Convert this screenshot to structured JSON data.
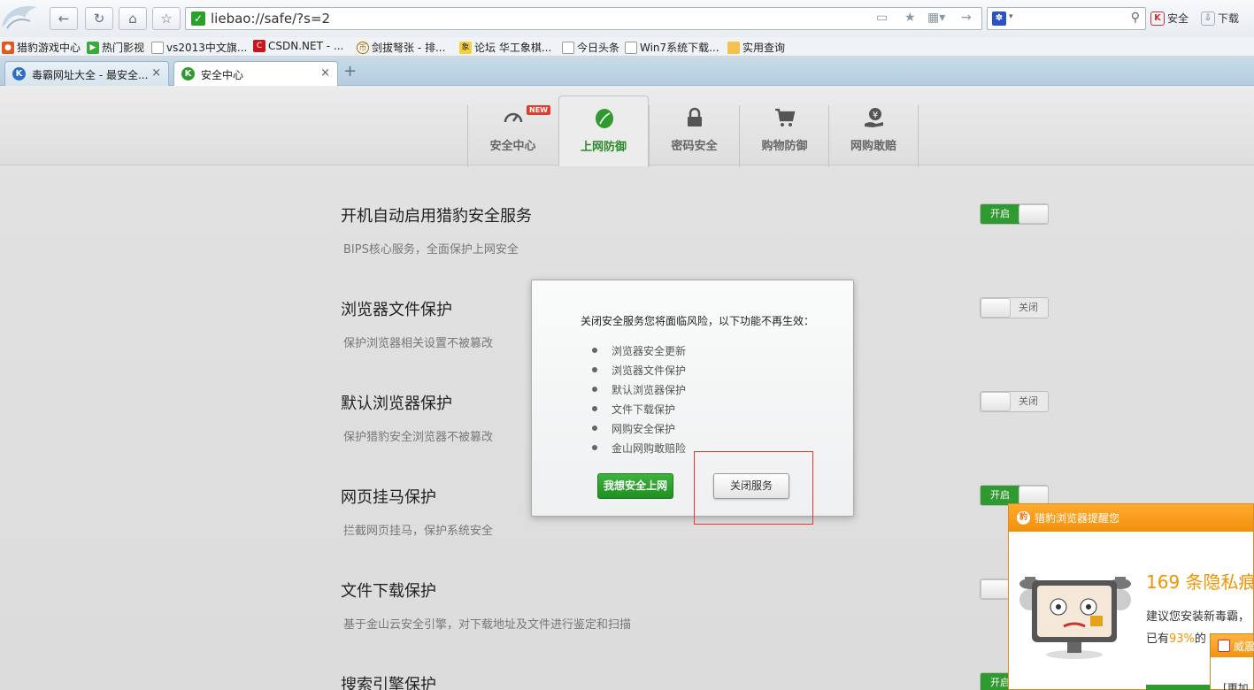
{
  "browser": {
    "url": "liebao://safe/?s=2",
    "toolbar_right": {
      "security": "安全",
      "download": "下载"
    },
    "bookmarks": [
      "猎豹游戏中心",
      "热门影视",
      "vs2013中文旗...",
      "CSDN.NET - ...",
      "剑拔弩张 - 排...",
      "论坛 华工象棋...",
      "今日头条",
      "Win7系统下载...",
      "实用查询"
    ],
    "tabs": [
      {
        "label": "毒霸网址大全 - 最安全...",
        "close": "×"
      },
      {
        "label": "安全中心",
        "close": "×"
      }
    ],
    "new_tab": "+"
  },
  "nav": {
    "items": [
      {
        "label": "安全中心",
        "icon": "speedometer-icon",
        "badge": "NEW"
      },
      {
        "label": "上网防御",
        "icon": "leaf-shield-icon"
      },
      {
        "label": "密码安全",
        "icon": "lock-icon"
      },
      {
        "label": "购物防御",
        "icon": "cart-icon"
      },
      {
        "label": "网购敢赔",
        "icon": "yuan-hand-icon"
      }
    ]
  },
  "settings": [
    {
      "title": "开机自动启用猎豹安全服务",
      "desc": "BIPS核心服务，全面保护上网安全",
      "state": "开启"
    },
    {
      "title": "浏览器文件保护",
      "desc": "保护浏览器相关设置不被篡改",
      "state": "关闭"
    },
    {
      "title": "默认浏览器保护",
      "desc": "保护猎豹安全浏览器不被篡改",
      "state": "关闭"
    },
    {
      "title": "网页挂马保护",
      "desc": "拦截网页挂马，保护系统安全",
      "state": "开启"
    },
    {
      "title": "文件下载保护",
      "desc": "基于金山云安全引擎，对下载地址及文件进行鉴定和扫描",
      "state": ""
    },
    {
      "title": "搜索引擎保护",
      "desc": "",
      "state": "开启"
    }
  ],
  "modal": {
    "title": "关闭安全服务您将面临风险，以下功能不再生效：",
    "items": [
      "浏览器安全更新",
      "浏览器文件保护",
      "默认浏览器保护",
      "文件下载保护",
      "网购安全保护",
      "金山网购敢赔险"
    ],
    "primary_button": "我想安全上网",
    "secondary_button": "关闭服务"
  },
  "popup": {
    "title": "猎豹浏览器提醒您",
    "headline": "169 条隐私痕",
    "line1": "建议您安装新毒霸，",
    "line2_prefix": "已有",
    "line2_pct": "93%",
    "line2_suffix": "的"
  },
  "warn": {
    "title": "威震",
    "body": "[更加"
  },
  "colors": {
    "accent_green": "#2f9a2f",
    "accent_orange": "#f29400",
    "highlight_red": "#ee3333"
  }
}
